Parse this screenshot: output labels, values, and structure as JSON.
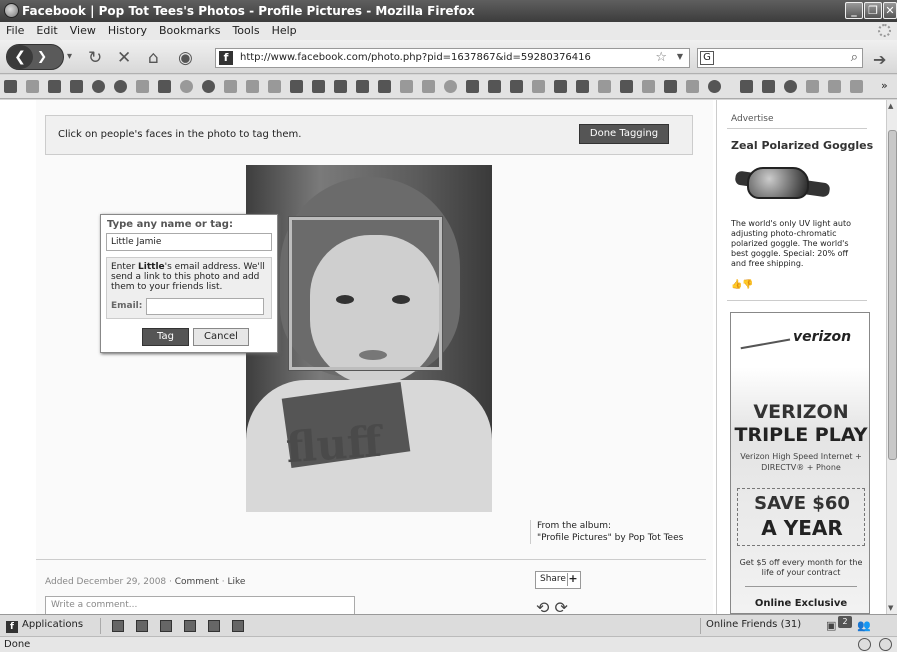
{
  "window": {
    "title": "Facebook | Pop Tot Tees's Photos - Profile Pictures - Mozilla Firefox",
    "minimize": "_",
    "maximize": "❐",
    "close": "✕"
  },
  "menu": [
    "File",
    "Edit",
    "View",
    "History",
    "Bookmarks",
    "Tools",
    "Help"
  ],
  "nav": {
    "url": "http://www.facebook.com/photo.php?pid=1637867&id=59280376416",
    "search_engine": "G",
    "search_value": ""
  },
  "tagging": {
    "hint": "Click on people's faces in the photo to tag them.",
    "done_label": "Done Tagging",
    "dialog_label": "Type any name or tag:",
    "name_value": "Little Jamie",
    "notice_pre": "Enter ",
    "notice_name": "Little",
    "notice_post": "'s email address. We'll send a link to this photo and add them to your friends list.",
    "email_label": "Email:",
    "email_value": "",
    "tag_label": "Tag",
    "cancel_label": "Cancel"
  },
  "photo": {
    "shirt_text": "fluff",
    "album_label": "From the album:",
    "album_name": "\"Profile Pictures\"",
    "album_by": " by Pop Tot Tees"
  },
  "post": {
    "added": "Added December 29, 2008 · ",
    "comment_link": "Comment",
    "dot": " · ",
    "like_link": "Like",
    "comment_placeholder": "Write a comment...",
    "share_label": "Share",
    "share_plus": "+"
  },
  "sidebar": {
    "advertise": "Advertise",
    "ad_title": "Zeal Polarized Goggles",
    "ad_body": "The world's only UV light auto adjusting photo-chromatic polarized goggle. The world's best goggle. Special: 20% off and free shipping.",
    "verizon_logo": "verizon",
    "verizon_line1": "VERIZON",
    "verizon_line2": "TRIPLE PLAY",
    "verizon_sub": "Verizon High Speed Internet + DIRECTV® + Phone",
    "save_line1": "SAVE $60",
    "save_line2": "A YEAR",
    "get_text": "Get $5 off every month for the life of your contract",
    "exclusive": "Online Exclusive"
  },
  "chatbar": {
    "applications": "Applications",
    "online_friends": "Online Friends (31)",
    "notif_count": "2"
  },
  "status": {
    "text": "Done"
  }
}
